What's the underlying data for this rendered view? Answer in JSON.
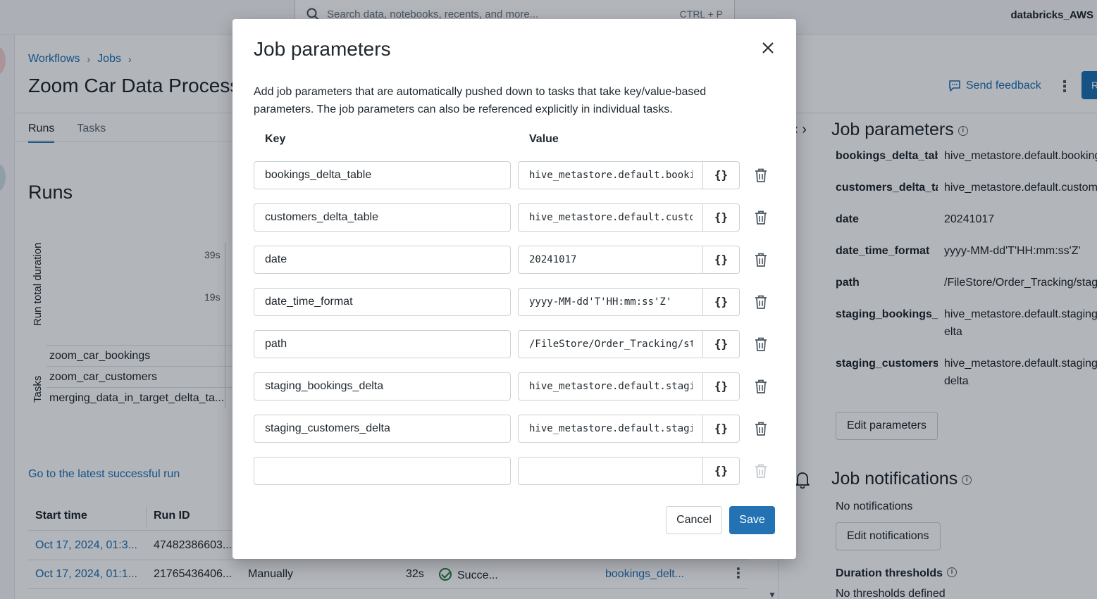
{
  "topbar": {
    "search_placeholder": "Search data, notebooks, recents, and more...",
    "search_shortcut": "CTRL + P",
    "workspace": "databricks_AWS"
  },
  "breadcrumb": {
    "items": [
      "Workflows",
      "Jobs"
    ]
  },
  "page": {
    "title": "Zoom Car Data Processing",
    "tabs": [
      "Runs",
      "Tasks"
    ],
    "active_tab": "Runs",
    "send_feedback": "Send feedback",
    "run_now_initial": "R"
  },
  "runs_section": {
    "title": "Runs",
    "ylabel": "Run total duration",
    "ticks": [
      "39s",
      "19s"
    ],
    "tasks_label": "Tasks",
    "task_names": [
      "zoom_car_bookings",
      "zoom_car_customers",
      "merging_data_in_target_delta_ta..."
    ],
    "latest_link": "Go to the latest successful run",
    "table": {
      "headers": [
        "Start time",
        "Run ID"
      ],
      "rows": [
        {
          "start": "Oct 17, 2024, 01:3...",
          "run_id": "47482386603..."
        },
        {
          "start": "Oct 17, 2024, 01:1...",
          "run_id": "21765436406...",
          "launched": "Manually",
          "duration": "32s",
          "status": "Succe...",
          "task_link": "bookings_delt..."
        }
      ]
    }
  },
  "right_panel": {
    "title": "Job parameters",
    "params": [
      {
        "key": "bookings_delta_tab",
        "value": "hive_metastore.default.bookings"
      },
      {
        "key": "customers_delta_tal",
        "value": "hive_metastore.default.customers"
      },
      {
        "key": "date",
        "value": "20241017"
      },
      {
        "key": "date_time_format",
        "value": "yyyy-MM-dd'T'HH:mm:ss'Z'"
      },
      {
        "key": "path",
        "value": "/FileStore/Order_Tracking/stag"
      },
      {
        "key": "staging_bookings_d",
        "value": "hive_metastore.default.staging_b",
        "value2": "elta"
      },
      {
        "key": "staging_customers_",
        "value": "hive_metastore.default.staging_c",
        "value2": "delta"
      }
    ],
    "edit_parameters": "Edit parameters",
    "notifications_title": "Job notifications",
    "no_notifications": "No notifications",
    "edit_notifications": "Edit notifications",
    "duration_title": "Duration thresholds",
    "no_thresholds": "No thresholds defined"
  },
  "modal": {
    "title": "Job parameters",
    "description": "Add job parameters that are automatically pushed down to tasks that take key/value-based parameters. The job parameters can also be referenced explicitly in individual tasks.",
    "key_header": "Key",
    "value_header": "Value",
    "rows": [
      {
        "key": "bookings_delta_table",
        "value": "hive_metastore.default.bookings_delta"
      },
      {
        "key": "customers_delta_table",
        "value": "hive_metastore.default.customers_delta"
      },
      {
        "key": "date",
        "value": "20241017"
      },
      {
        "key": "date_time_format",
        "value": "yyyy-MM-dd'T'HH:mm:ss'Z'"
      },
      {
        "key": "path",
        "value": "/FileStore/Order_Tracking/staging"
      },
      {
        "key": "staging_bookings_delta",
        "value": "hive_metastore.default.staging_bookings_delta"
      },
      {
        "key": "staging_customers_delta",
        "value": "hive_metastore.default.staging_customers_delta"
      },
      {
        "key": "",
        "value": ""
      }
    ],
    "brace_label": "{}",
    "cancel_label": "Cancel",
    "save_label": "Save"
  },
  "colors": {
    "accent": "#2272b4",
    "success": "#277c43",
    "border": "#cbd2d6"
  }
}
